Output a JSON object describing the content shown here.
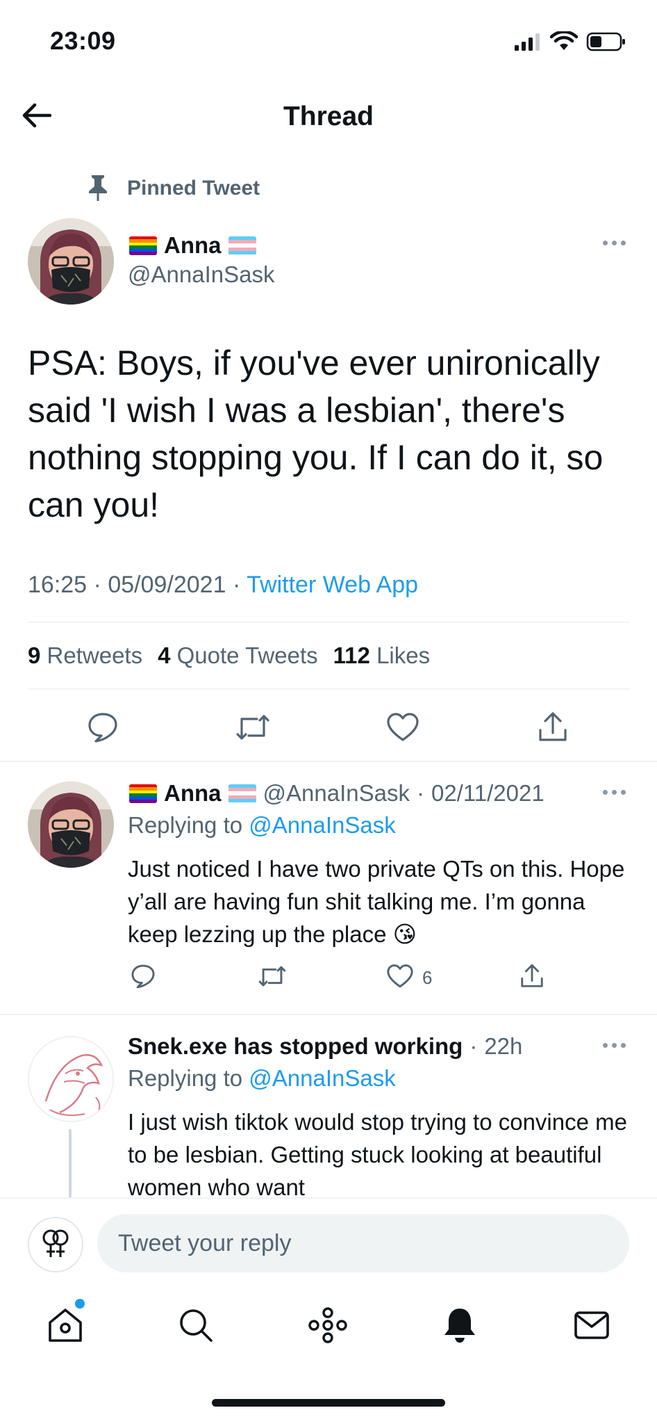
{
  "status_bar": {
    "time": "23:09"
  },
  "header": {
    "title": "Thread"
  },
  "pinned": {
    "label": "Pinned Tweet"
  },
  "main_tweet": {
    "author_name": "Anna",
    "author_handle": "@AnnaInSask",
    "text": "PSA: Boys, if you've ever unironically said 'I wish I was a lesbian', there's nothing stopping you. If I can do it, so can you!",
    "time": "16:25",
    "date": "05/09/2021",
    "source": "Twitter Web App",
    "sep": "·",
    "retweets_count": "9",
    "retweets_label": "Retweets",
    "quotes_count": "4",
    "quotes_label": "Quote Tweets",
    "likes_count": "112",
    "likes_label": "Likes"
  },
  "replies": [
    {
      "author_name": "Anna",
      "author_handle": "@AnnaInSask",
      "date": "02/11/2021",
      "replying_label": "Replying to",
      "replying_handle": "@AnnaInSask",
      "text": "Just noticed I have two private QTs on this. Hope y’all are having fun shit talking me. I’m gonna keep lezzing up the place 😘",
      "like_count": "6"
    },
    {
      "author_name": "Snek.exe has stopped working",
      "age": "22h",
      "replying_label": "Replying to",
      "replying_handle": "@AnnaInSask",
      "text": "I just wish tiktok would stop trying to convince me to be lesbian. Getting stuck looking at beautiful women who want"
    }
  ],
  "compose": {
    "placeholder": "Tweet your reply"
  },
  "tabs": [
    "home",
    "search",
    "spaces",
    "notifications",
    "messages"
  ],
  "colors": {
    "accent": "#1d9bf0",
    "text": "#0f1419",
    "muted": "#536471",
    "divider": "#eff3f4"
  }
}
